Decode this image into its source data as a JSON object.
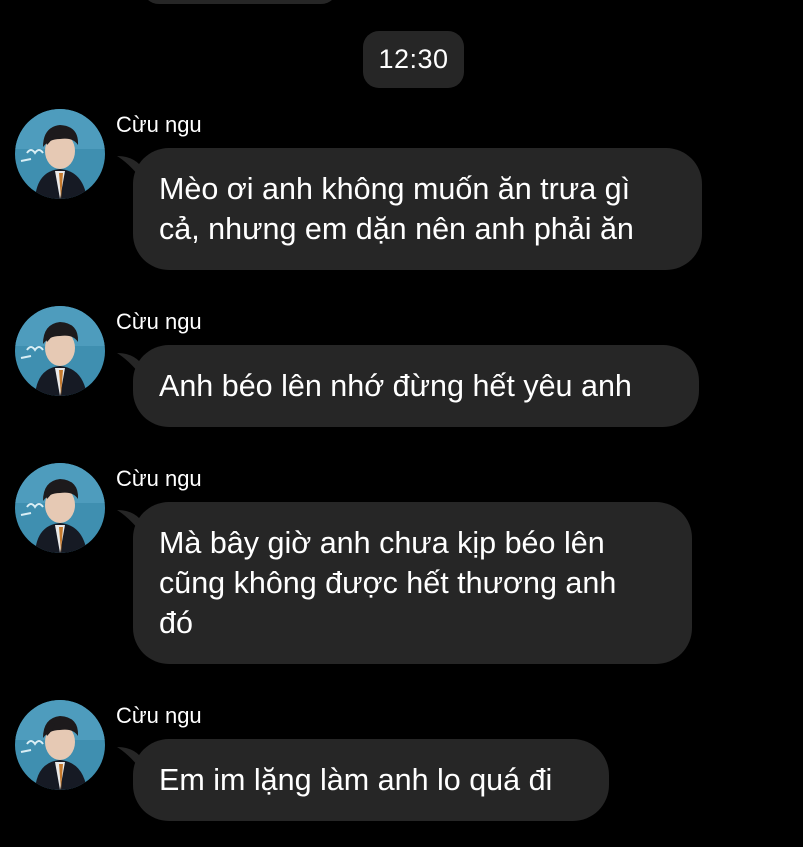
{
  "chat": {
    "timestamp": "12:30",
    "messages": [
      {
        "sender": "Cừu ngu",
        "lines": [
          "Mèo ơi anh không muốn ăn trưa gì",
          "cả, nhưng em dặn nên anh phải ăn"
        ]
      },
      {
        "sender": "Cừu ngu",
        "lines": [
          "Anh béo lên nhớ đừng hết yêu anh"
        ]
      },
      {
        "sender": "Cừu ngu",
        "lines": [
          "Mà bây giờ anh chưa kịp béo lên",
          "cũng không được hết thương anh",
          "đó"
        ]
      },
      {
        "sender": "Cừu ngu",
        "lines": [
          "Em im lặng làm anh lo quá đi"
        ]
      }
    ]
  },
  "colors": {
    "background": "#000000",
    "bubble": "#262626",
    "text": "#ffffff",
    "avatar_bg": "#3f8fb0"
  }
}
